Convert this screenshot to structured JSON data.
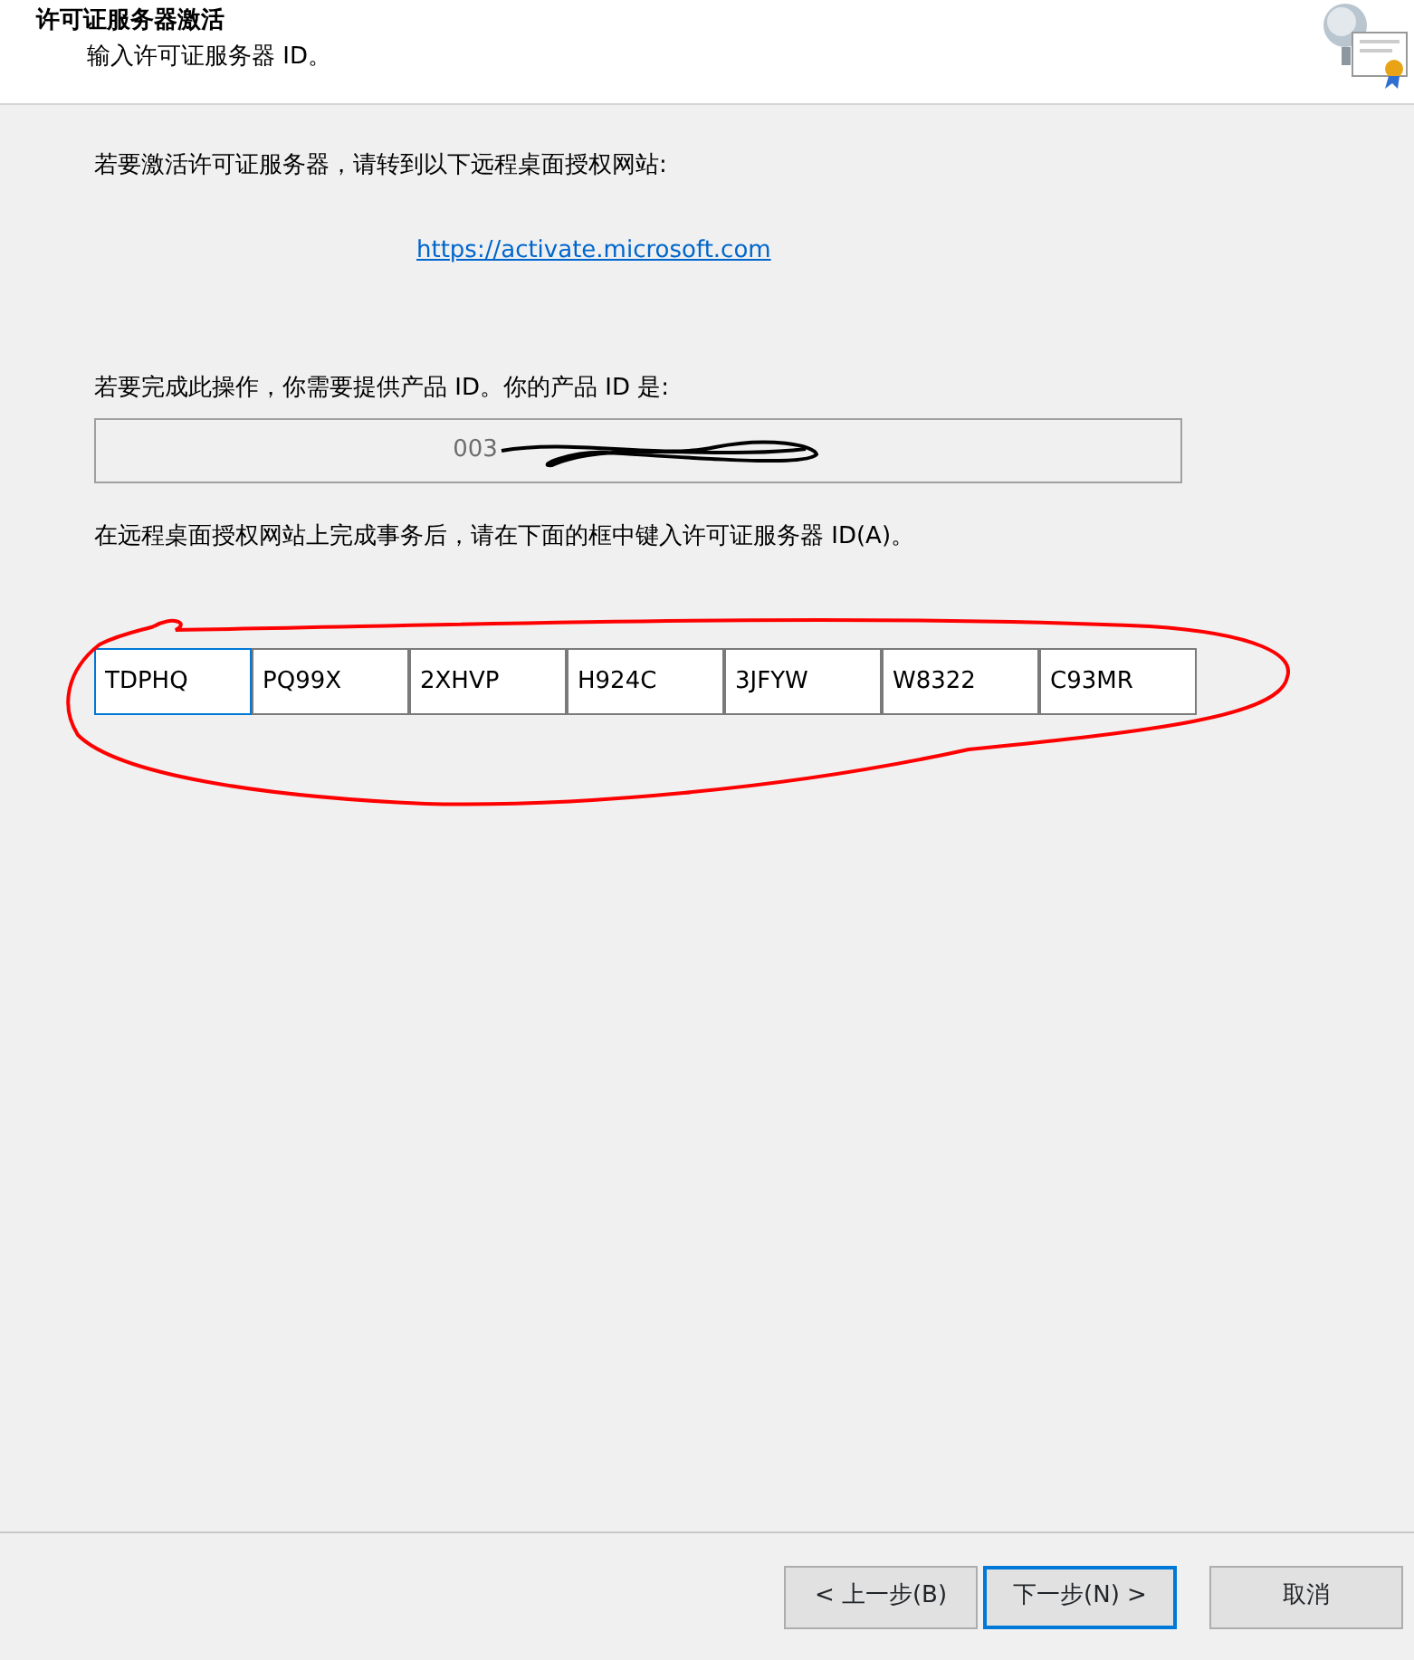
{
  "header": {
    "title": "许可证服务器激活",
    "subtitle": "输入许可证服务器 ID。"
  },
  "intro": "若要激活许可证服务器，请转到以下远程桌面授权网站:",
  "link": "https://activate.microsoft.com",
  "product_prompt": "若要完成此操作，你需要提供产品 ID。你的产品 ID 是:",
  "product_id": {
    "visible_text": "003",
    "redacted": true
  },
  "server_prompt": "在远程桌面授权网站上完成事务后，请在下面的框中键入许可证服务器 ID(A)。",
  "server_id_fields": [
    {
      "value": "TDPHQ",
      "focused": true
    },
    {
      "value": "PQ99X",
      "focused": false
    },
    {
      "value": "2XHVP",
      "focused": false
    },
    {
      "value": "H924C",
      "focused": false
    },
    {
      "value": "3JFYW",
      "focused": false
    },
    {
      "value": "W8322",
      "focused": false
    },
    {
      "value": "C93MR",
      "focused": false
    }
  ],
  "annotation": {
    "kind": "circle",
    "color": "#ff0000"
  },
  "buttons": [
    {
      "label": "< 上一步(B)",
      "default": false
    },
    {
      "label": "下一步(N) >",
      "default": true
    },
    {
      "label": "取消",
      "default": false
    }
  ]
}
